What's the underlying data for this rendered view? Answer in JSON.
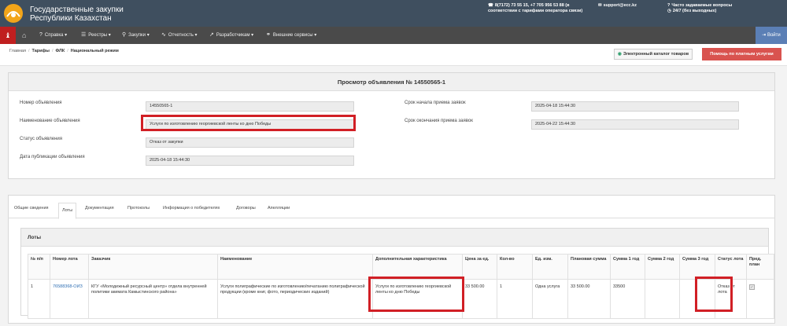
{
  "header": {
    "brand_line1": "Государственные закупки",
    "brand_line2": "Республики Казахстан",
    "phone_line1": "8(7172) 73 55 15, +7 705 956 53 88 (в",
    "phone_line2": "соответствии с тарифами оператора связи)",
    "email": "support@ecc.kz",
    "faq": "Часто задаваемые вопросы",
    "hours": "24/7 (без выходных)"
  },
  "nav": {
    "items": [
      {
        "label": "Справка",
        "icon": "help-icon"
      },
      {
        "label": "Реестры",
        "icon": "registry-icon"
      },
      {
        "label": "Закупки",
        "icon": "search-icon"
      },
      {
        "label": "Отчетность",
        "icon": "chart-icon"
      },
      {
        "label": "Разработчикам",
        "icon": "code-icon"
      },
      {
        "label": "Внешние сервисы",
        "icon": "link-icon"
      }
    ],
    "login": "Войти"
  },
  "breadcrumb": {
    "home": "Главная",
    "tariffs": "Тарифы",
    "flk": "ФЛК",
    "national": "Национальный режим"
  },
  "toolbar": {
    "catalog": "Электронный каталог товаров",
    "help": "Помощь по платным услугам"
  },
  "announcement": {
    "title": "Просмотр объявления № 14550565-1",
    "number_label": "Номер объявления",
    "number_value": "14550565-1",
    "name_label": "Наименование объявления",
    "name_value": "Услуги по изготовлению георгиевской ленты ко дню Победы",
    "status_label": "Статус объявления",
    "status_value": "Отказ от закупки",
    "pub_label": "Дата публикации объявления",
    "pub_value": "2025-04-18 15:44:30",
    "start_label": "Срок начала приема заявок",
    "start_value": "2025-04-18 15:44:30",
    "end_label": "Срок окончания приема заявок",
    "end_value": "2025-04-22 15:44:30"
  },
  "tabs": [
    "Общие сведения",
    "Лоты",
    "Документация",
    "Протоколы",
    "Информация о победителях",
    "Договоры",
    "Апелляции"
  ],
  "lots": {
    "title": "Лоты",
    "columns": [
      "№ п/п",
      "Номер лота",
      "Заказчик",
      "Наименование",
      "Дополнительная характеристика",
      "Цена за ед.",
      "Кол-во",
      "Ед. изм.",
      "Плановая сумма",
      "Сумма 1 год",
      "Сумма 2 год",
      "Сумма 3 год",
      "Статус лота",
      "Пред. план"
    ],
    "row": {
      "num": "1",
      "lot_number": "76588368-ОИЗ",
      "customer": "КГУ «Молодежный ресурсный центр» отдела внутренней политики акимата Камыстинского района»",
      "name": "Услуги полиграфические по изготовлению/печатанию полиграфической продукции (кроме книг, фото, периодических изданий)",
      "extra": "Услуги по изготовлению георгиевской ленты ко дню Победы",
      "price": "33 500.00",
      "qty": "1",
      "unit": "Одна услуга",
      "planned": "33 500.00",
      "year1": "33500",
      "year2": "",
      "year3": "",
      "status": "Отказ от лота",
      "preplan": "✓"
    }
  },
  "colors": {
    "header_bg": "#3f4f5f",
    "nav_bg": "#4a4a4a",
    "accent_red": "#d9534f",
    "highlight_red": "#d11f25",
    "login_blue": "#5b7fb5",
    "link_blue": "#2f6fb3"
  }
}
